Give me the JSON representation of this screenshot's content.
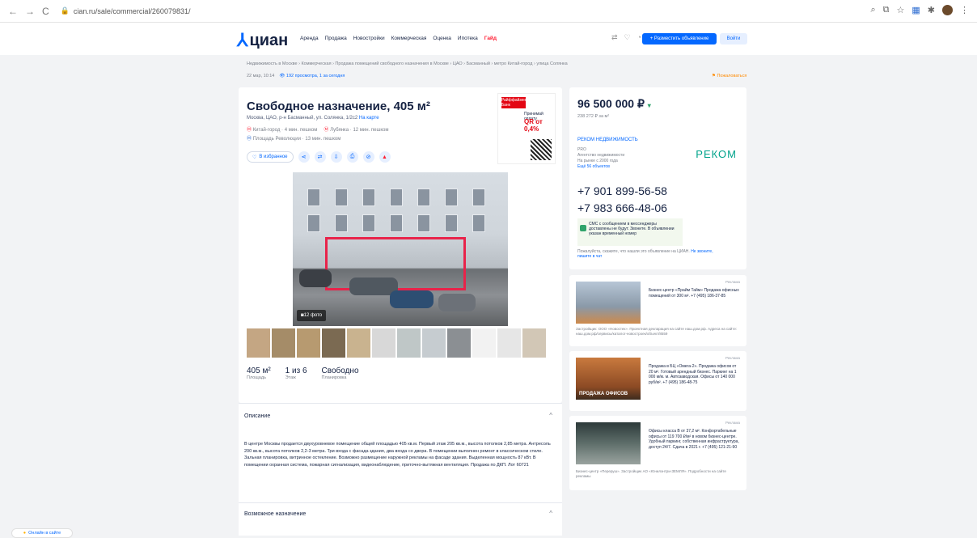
{
  "browser": {
    "url": "cian.ru/sale/commercial/260079831/",
    "nav": [
      "←",
      "→",
      "C"
    ]
  },
  "header": {
    "logo": "циан",
    "menu": [
      "Аренда",
      "Продажа",
      "Новостройки",
      "Коммерческая",
      "Оценка",
      "Ипотека",
      "Гайд"
    ],
    "place_ad": "+ Разместить объявление",
    "login": "Войти"
  },
  "breadcrumbs": "Недвижимость в Москве  ›  Коммерческая  ›  Продажа помещений свободного назначения в Москве  ›  ЦАО  ›  Басманный  ›  метро Китай-город  ›  улица Солянка",
  "meta": {
    "date": "22 мар, 10:14",
    "views": "192 просмотра, 1 за сегодня",
    "complain": "Пожаловаться"
  },
  "listing": {
    "title": "Свободное назначение, 405 м²",
    "address": "Москва, ЦАО, р-н Басманный, ул. Солянка, 1/2с2",
    "map_link": "На карте",
    "metro": [
      {
        "name": "Китай-город",
        "time": "4 мин. пешком"
      },
      {
        "name": "Лубянка",
        "time": "12 мин. пешком"
      },
      {
        "name": "Площадь Революции",
        "time": "13 мин. пешком"
      }
    ],
    "favorite": "В избранное",
    "photo_count": "12 фото",
    "stats": [
      {
        "value": "405 м²",
        "label": "Площадь"
      },
      {
        "value": "1 из 6",
        "label": "Этаж"
      },
      {
        "value": "Свободно",
        "label": "Планировка"
      }
    ]
  },
  "ad_banner": {
    "bank": "Райффайзен Банк",
    "line1": "Принимай оплату",
    "line2": "QR от 0,4%"
  },
  "description": {
    "heading": "Описание",
    "text": "В центре Москвы продается двухуровневое помещение общей площадью 405 кв.м. Первый этаж 205 кв.м., высота потолков 2,85 метра. Антресоль 200 кв.м., высота потолков 2,2-3 метра. Три входа с фасада здания, два входа со двора. В помещении выполнен ремонт в классическом стиле. Зальная планировка, витринное остекление. Возможно размещение наружной рекламы на фасаде здания. Выделенная мощность 87 кВт. В помещении охранная система, пожарная сигнализация, видеонаблюдение, приточно-вытяжная вентиляция. Продажа по ДКП. Лот 60721",
    "purpose_heading": "Возможное назначение"
  },
  "sidebar": {
    "price": "96 500 000 ₽",
    "price_per_m": "238 272 ₽ за м²",
    "agency_name": "РЕКОМ НЕДВИЖИМОСТЬ",
    "agency_badge": "PRO",
    "agency_type": "Агентство недвижимости",
    "agency_since": "На рынке с 2000 года",
    "agency_more": "Ещё 56 объектов",
    "agency_logo": "РЕКОМ",
    "phone1": "+7 901 899-56-58",
    "phone2": "+7 983 666-48-06",
    "notice": "СМС с сообщением в мессенджеры доставлены не будут. Звоните. В объявлении указан временный номер",
    "note": "Пожалуйста, скажите, что нашли это объявление на ЦИАН.",
    "note_link": "Не звоните, пишите в чат"
  },
  "ads": [
    {
      "label": "Реклама",
      "text": "Бизнес-центр «Прайм Тайм» Продажа офисных помещений от 300 м². +7 (495) 186-37-85",
      "foot": "Застройщик: ООО «Новостек». Проектная декларация на сайте наш.дом.рф. Адреса на сайте: наш.дом.рф/сервисы/каталог-новостроек/объект/8559"
    },
    {
      "label": "Реклама",
      "text": "Продажа в БЦ «Омега-2». Продажа офисов от 20 м². Готовый арендный бизнес. Паркинг на 1 000 м/м. м. Автозаводская. Офисы от 140 000 руб/м². +7 (495) 186-48-75",
      "foot": "",
      "overlay": "ПРОДАЖА ОФИСОВ"
    },
    {
      "label": "Реклама",
      "text": "Офисы класса В от 37,2 м². Конфортабельные офисы от 119 700 ₽/м² в новом бизнес-центре. Удобный паркинг, собственная инфраструктура, доступ 24/7. Сдача в 2021 г. +7 (495) 121-21-90",
      "foot": "Бизнес-центр «Переруш». Застройщик АО «Юнилэнтри-ЗЕМЛЯ». Подробности на сайте рекламы"
    }
  ],
  "help_button": "Онлайн в сайте"
}
